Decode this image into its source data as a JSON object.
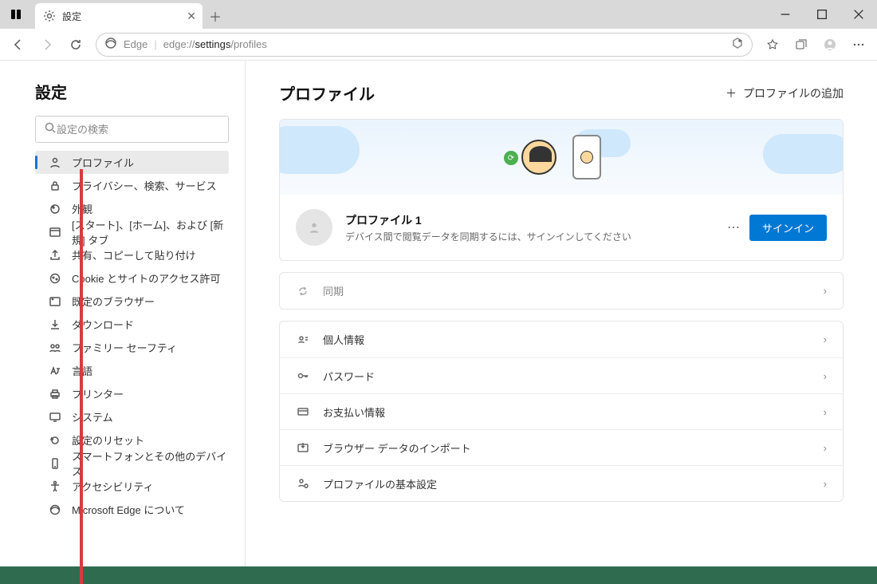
{
  "window": {
    "tab_title": "設定",
    "minimize": "—",
    "maximize": "▢",
    "close": "✕"
  },
  "toolbar": {
    "edge_label": "Edge",
    "url_prefix": "edge://",
    "url_bold": "settings",
    "url_suffix": "/profiles"
  },
  "sidebar": {
    "title": "設定",
    "search_placeholder": "設定の検索",
    "items": [
      {
        "label": "プロファイル"
      },
      {
        "label": "プライバシー、検索、サービス"
      },
      {
        "label": "外観"
      },
      {
        "label": "[スタート]、[ホーム]、および [新規] タブ"
      },
      {
        "label": "共有、コピーして貼り付け"
      },
      {
        "label": "Cookie とサイトのアクセス許可"
      },
      {
        "label": "既定のブラウザー"
      },
      {
        "label": "ダウンロード"
      },
      {
        "label": "ファミリー セーフティ"
      },
      {
        "label": "言語"
      },
      {
        "label": "プリンター"
      },
      {
        "label": "システム"
      },
      {
        "label": "設定のリセット"
      },
      {
        "label": "スマートフォンとその他のデバイス"
      },
      {
        "label": "アクセシビリティ"
      },
      {
        "label": "Microsoft Edge について"
      }
    ]
  },
  "main": {
    "title": "プロファイル",
    "add_profile": "プロファイルの追加",
    "profile": {
      "name": "プロファイル 1",
      "desc": "デバイス間で閲覧データを同期するには、サインインしてください",
      "signin": "サインイン"
    },
    "rows": [
      {
        "label": "同期",
        "key": "sync"
      },
      {
        "label": "個人情報",
        "key": "personal"
      },
      {
        "label": "パスワード",
        "key": "password"
      },
      {
        "label": "お支払い情報",
        "key": "payment"
      },
      {
        "label": "ブラウザー データのインポート",
        "key": "import"
      },
      {
        "label": "プロファイルの基本設定",
        "key": "prefs"
      }
    ]
  }
}
